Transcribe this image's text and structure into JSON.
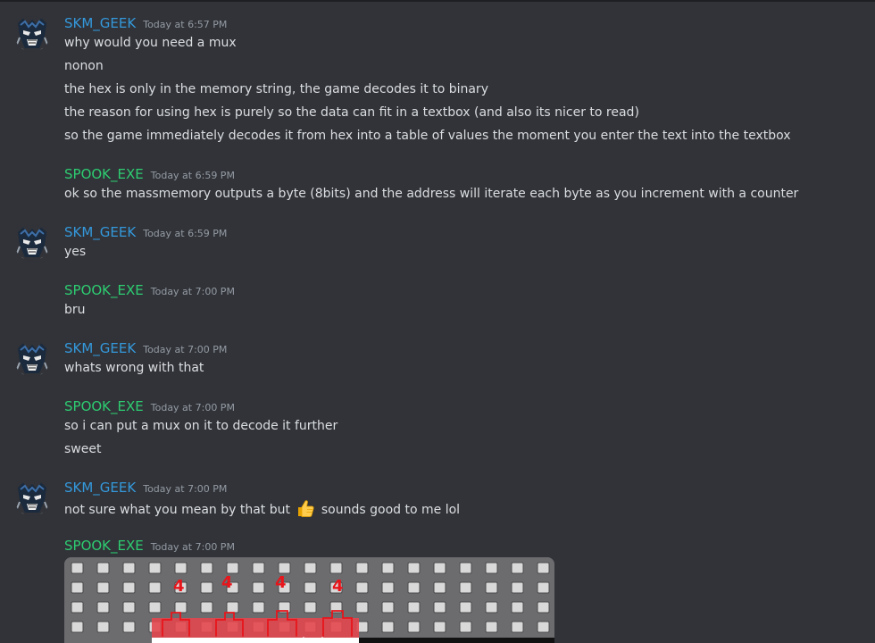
{
  "messages": [
    {
      "author": "SKM_GEEK",
      "time": "Today at 6:57 PM",
      "lines": [
        "why would you need a mux",
        "nonon",
        "the hex is only in the memory string, the game decodes it to binary",
        "the reason for using hex is purely so the data can fit in a textbox (and also its nicer to read)",
        "so the game immediately decodes it from hex into a table of values the moment you enter the text into the textbox"
      ]
    },
    {
      "author": "SPOOK_EXE",
      "time": "Today at 6:59 PM",
      "lines": [
        "ok so the massmemory outputs a byte (8bits) and the address will iterate each byte as you increment with a counter"
      ]
    },
    {
      "author": "SKM_GEEK",
      "time": "Today at 6:59 PM",
      "lines": [
        "yes"
      ]
    },
    {
      "author": "SPOOK_EXE",
      "time": "Today at 7:00 PM",
      "lines": [
        "bru"
      ]
    },
    {
      "author": "SKM_GEEK",
      "time": "Today at 7:00 PM",
      "lines": [
        "whats wrong with that"
      ]
    },
    {
      "author": "SPOOK_EXE",
      "time": "Today at 7:00 PM",
      "lines": [
        "so i can put a mux on it to decode it further",
        "sweet"
      ]
    },
    {
      "author": "SKM_GEEK",
      "time": "Today at 7:00 PM",
      "lines": [
        "not sure what you mean by that but",
        "sounds good to me lol"
      ],
      "emoji": "thumbs-up-emoji"
    },
    {
      "author": "SPOOK_EXE",
      "time": "Today at 7:00 PM",
      "lines": [],
      "attachment": "image-attachment"
    }
  ],
  "annotations": [
    "4",
    "4",
    "4",
    "4"
  ],
  "colors": {
    "background": "#313338",
    "skm_name": "#3498db",
    "spook_name": "#2ecc71",
    "message_text": "#dbdee1",
    "timestamp": "#949ba4"
  }
}
